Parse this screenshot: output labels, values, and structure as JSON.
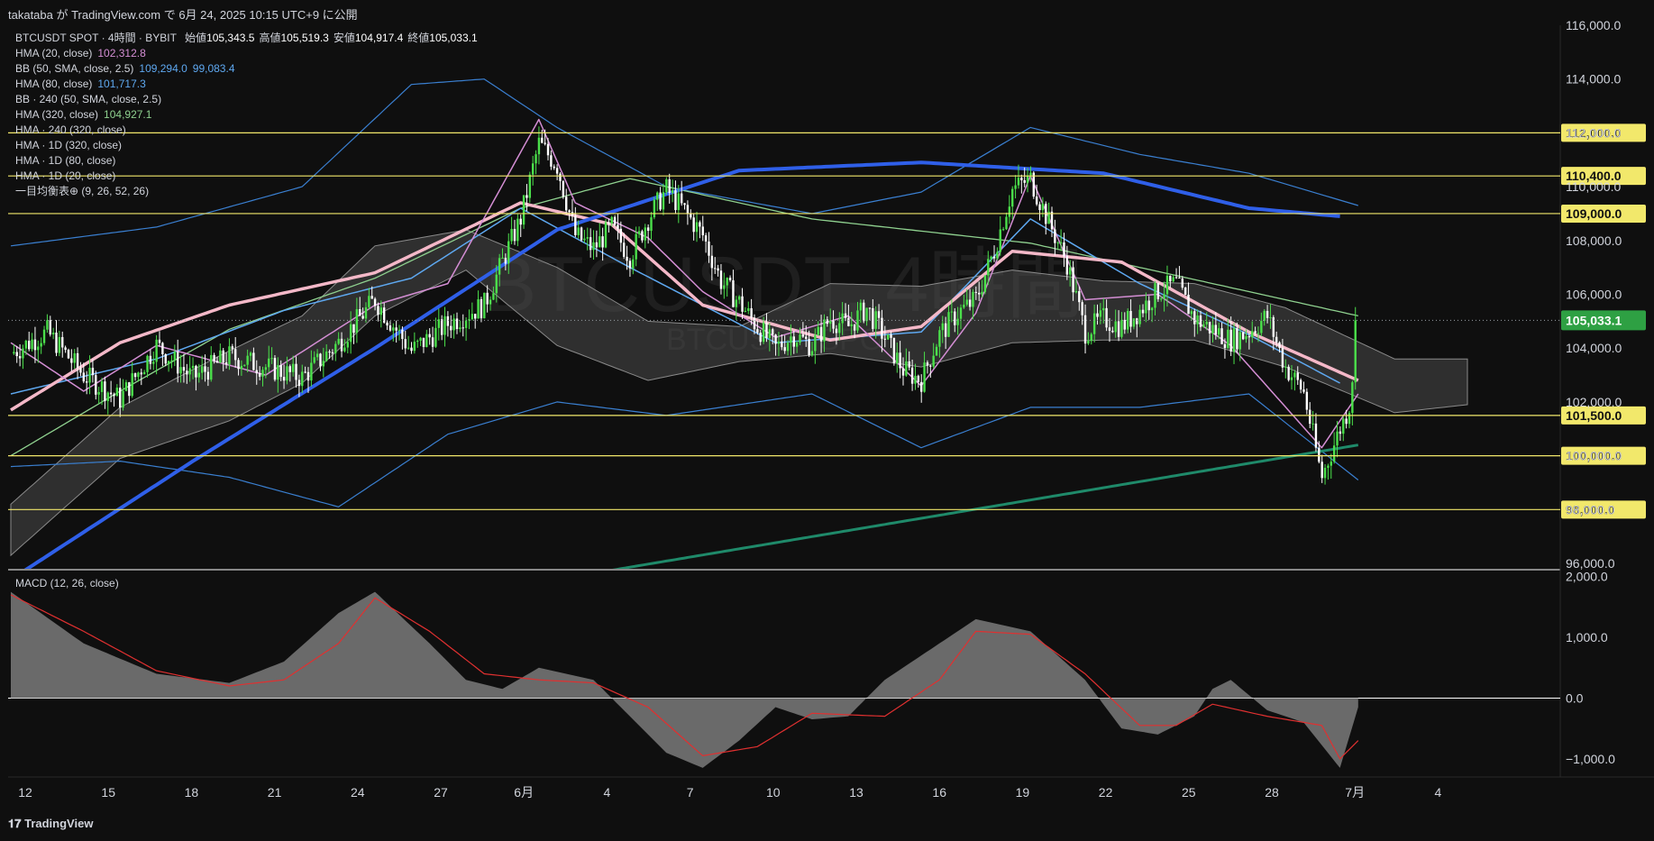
{
  "header": {
    "publish_text": "takataba が TradingView.com で 6月 24, 2025 10:15 UTC+9 に公開"
  },
  "watermark": {
    "line1": "BTCUSDT, 4時間",
    "line2": "BTCUSDT SPOT"
  },
  "legend": {
    "symbol": "BTCUSDT SPOT · 4時間 · BYBIT",
    "ohlc": [
      {
        "label": "始値",
        "value": "105,343.5"
      },
      {
        "label": "高値",
        "value": "105,519.3"
      },
      {
        "label": "安値",
        "value": "104,917.4"
      },
      {
        "label": "終値",
        "value": "105,033.1"
      }
    ],
    "indicators": [
      {
        "name": "HMA (20, close)",
        "values": [
          "102,312.8"
        ],
        "colors": [
          "#d48ed4"
        ]
      },
      {
        "name": "BB (50, SMA, close, 2.5)",
        "values": [
          "109,294.0",
          "99,083.4"
        ],
        "colors": [
          "#5ea8f0",
          "#5ea8f0"
        ]
      },
      {
        "name": "HMA (80, close)",
        "values": [
          "101,717.3"
        ],
        "colors": [
          "#5ea8f0"
        ]
      },
      {
        "name": "BB · 240 (50, SMA, close, 2.5)",
        "values": [],
        "colors": []
      },
      {
        "name": "HMA (320, close)",
        "values": [
          "104,927.1"
        ],
        "colors": [
          "#8fd18f"
        ]
      },
      {
        "name": "HMA · 240 (320, close)",
        "values": [],
        "colors": []
      },
      {
        "name": "HMA · 1D (320, close)",
        "values": [],
        "colors": []
      },
      {
        "name": "HMA · 1D (80, close)",
        "values": [],
        "colors": []
      },
      {
        "name": "HMA · 1D (20, close)",
        "values": [],
        "colors": []
      },
      {
        "name": "一目均衡表⊕ (9, 26, 52, 26)",
        "values": [],
        "colors": []
      }
    ]
  },
  "macd_label": "MACD (12, 26, close)",
  "footer": {
    "logo_text": "TradingView"
  },
  "colors": {
    "up": "#4be04b",
    "down": "#ffffff",
    "hline": "#f2e86b",
    "hma20": "#d48ed4",
    "hma80": "#5ea8f0",
    "hma320": "#8fd18f",
    "hma240": "#f4b8c8",
    "hma1d": "#2f5fe8",
    "trend": "#1f8a6a",
    "bb": "#3a7fd0",
    "cloud": "#4a4a4a",
    "macd_signal": "#e03030",
    "macd_hist": "#7a7a7a",
    "price_badge": "#2ea043",
    "level_badge": "#f2e86b"
  },
  "chart_data": [
    {
      "type": "candlestick",
      "title": "BTCUSDT SPOT · 4時間 · BYBIT",
      "xlabel": "",
      "ylabel": "",
      "x_ticks": [
        "12",
        "15",
        "18",
        "21",
        "24",
        "27",
        "6月",
        "4",
        "7",
        "10",
        "13",
        "16",
        "19",
        "22",
        "25",
        "28",
        "7月",
        "4"
      ],
      "y_ticks": [
        "96,000.0",
        "98,000.0",
        "100,000.0",
        "102,000.0",
        "104,000.0",
        "106,000.0",
        "108,000.0",
        "110,000.0",
        "112,000.0",
        "114,000.0",
        "116,000.0"
      ],
      "ylim": [
        95800,
        116000
      ],
      "last_price": {
        "value": 105033.1,
        "label": "105,033.1"
      },
      "horizontal_levels": [
        {
          "value": 112000,
          "label": "112,000.0"
        },
        {
          "value": 110400,
          "label": "110,400.0"
        },
        {
          "value": 109000,
          "label": "109,000.0"
        },
        {
          "value": 101500,
          "label": "101,500.0"
        },
        {
          "value": 100000,
          "label": "100,000.0"
        },
        {
          "value": 98000,
          "label": "98,000.0"
        }
      ],
      "price_path": [
        [
          0,
          103800
        ],
        [
          2,
          104600
        ],
        [
          4,
          103000
        ],
        [
          6,
          102100
        ],
        [
          8,
          104100
        ],
        [
          10,
          102900
        ],
        [
          12,
          103700
        ],
        [
          14,
          103300
        ],
        [
          16,
          102900
        ],
        [
          18,
          104200
        ],
        [
          20,
          105800
        ],
        [
          22,
          103900
        ],
        [
          24,
          104900
        ],
        [
          26,
          105600
        ],
        [
          28,
          108800
        ],
        [
          29,
          111600
        ],
        [
          30,
          110800
        ],
        [
          31,
          108200
        ],
        [
          32,
          107700
        ],
        [
          33,
          108500
        ],
        [
          34,
          107400
        ],
        [
          35,
          108800
        ],
        [
          36,
          109900
        ],
        [
          37,
          109100
        ],
        [
          38,
          108200
        ],
        [
          39,
          106500
        ],
        [
          40,
          105700
        ],
        [
          41,
          104800
        ],
        [
          42,
          104000
        ],
        [
          43,
          104500
        ],
        [
          44,
          104100
        ],
        [
          45,
          105100
        ],
        [
          46,
          104800
        ],
        [
          47,
          105500
        ],
        [
          48,
          104400
        ],
        [
          49,
          103200
        ],
        [
          50,
          102800
        ],
        [
          51,
          104500
        ],
        [
          52,
          105300
        ],
        [
          53,
          105800
        ],
        [
          54,
          107600
        ],
        [
          55,
          109900
        ],
        [
          56,
          110300
        ],
        [
          57,
          108700
        ],
        [
          58,
          107200
        ],
        [
          59,
          104600
        ],
        [
          60,
          105100
        ],
        [
          61,
          104800
        ],
        [
          62,
          105400
        ],
        [
          63,
          106100
        ],
        [
          64,
          106400
        ],
        [
          65,
          105100
        ],
        [
          66,
          104700
        ],
        [
          67,
          104300
        ],
        [
          68,
          104600
        ],
        [
          69,
          105200
        ],
        [
          70,
          103300
        ],
        [
          71,
          102400
        ],
        [
          72,
          99200
        ],
        [
          73,
          101000
        ],
        [
          73.5,
          101800
        ],
        [
          74,
          105033
        ]
      ],
      "overlays": {
        "hma1d_20": [
          [
            0,
            95400
          ],
          [
            10,
            99800
          ],
          [
            20,
            104000
          ],
          [
            30,
            108400
          ],
          [
            40,
            110600
          ],
          [
            50,
            110900
          ],
          [
            60,
            110500
          ],
          [
            68,
            109200
          ],
          [
            73,
            108900
          ]
        ],
        "hma240_320": [
          [
            0,
            101700
          ],
          [
            6,
            104200
          ],
          [
            12,
            105600
          ],
          [
            20,
            106800
          ],
          [
            28,
            109400
          ],
          [
            33,
            108600
          ],
          [
            38,
            105600
          ],
          [
            45,
            104300
          ],
          [
            50,
            104800
          ],
          [
            55,
            107600
          ],
          [
            61,
            107200
          ],
          [
            68,
            104600
          ],
          [
            74,
            102800
          ]
        ],
        "hma320": [
          [
            0,
            100000
          ],
          [
            6,
            102400
          ],
          [
            12,
            104700
          ],
          [
            20,
            106600
          ],
          [
            28,
            109200
          ],
          [
            34,
            110300
          ],
          [
            44,
            108800
          ],
          [
            56,
            107900
          ],
          [
            64,
            106700
          ],
          [
            74,
            105200
          ]
        ],
        "hma80": [
          [
            0,
            102300
          ],
          [
            8,
            103600
          ],
          [
            15,
            105400
          ],
          [
            22,
            106600
          ],
          [
            28,
            109200
          ],
          [
            34,
            107000
          ],
          [
            42,
            104200
          ],
          [
            50,
            104600
          ],
          [
            56,
            108800
          ],
          [
            62,
            106400
          ],
          [
            68,
            104500
          ],
          [
            73,
            102700
          ]
        ],
        "hma20": [
          [
            0,
            104200
          ],
          [
            4,
            102400
          ],
          [
            8,
            104100
          ],
          [
            14,
            103000
          ],
          [
            20,
            105600
          ],
          [
            24,
            106400
          ],
          [
            29,
            112500
          ],
          [
            31,
            109400
          ],
          [
            35,
            108100
          ],
          [
            38,
            106100
          ],
          [
            42,
            104400
          ],
          [
            46,
            105200
          ],
          [
            50,
            102600
          ],
          [
            53,
            105300
          ],
          [
            56,
            110400
          ],
          [
            59,
            105800
          ],
          [
            63,
            106000
          ],
          [
            67,
            104100
          ],
          [
            72,
            100300
          ],
          [
            74,
            102300
          ]
        ],
        "bb_upper": [
          [
            0,
            107800
          ],
          [
            8,
            108500
          ],
          [
            16,
            110000
          ],
          [
            22,
            113800
          ],
          [
            26,
            114000
          ],
          [
            30,
            112200
          ],
          [
            36,
            110000
          ],
          [
            44,
            109000
          ],
          [
            50,
            109800
          ],
          [
            56,
            112200
          ],
          [
            62,
            111200
          ],
          [
            68,
            110500
          ],
          [
            74,
            109300
          ]
        ],
        "bb_lower": [
          [
            0,
            99600
          ],
          [
            6,
            99800
          ],
          [
            12,
            99200
          ],
          [
            18,
            98100
          ],
          [
            24,
            100800
          ],
          [
            30,
            102000
          ],
          [
            36,
            101500
          ],
          [
            44,
            102300
          ],
          [
            50,
            100300
          ],
          [
            56,
            101800
          ],
          [
            62,
            101800
          ],
          [
            68,
            102300
          ],
          [
            74,
            99100
          ]
        ],
        "trendline": [
          [
            0,
            92000
          ],
          [
            74,
            100400
          ]
        ],
        "cloud_upper": [
          [
            0,
            98200
          ],
          [
            6,
            101800
          ],
          [
            12,
            103900
          ],
          [
            16,
            105200
          ],
          [
            20,
            107800
          ],
          [
            25,
            108400
          ],
          [
            30,
            107000
          ],
          [
            35,
            105000
          ],
          [
            40,
            104800
          ],
          [
            45,
            106400
          ],
          [
            50,
            106300
          ],
          [
            55,
            106900
          ],
          [
            60,
            106500
          ],
          [
            65,
            106400
          ],
          [
            70,
            105500
          ],
          [
            76,
            103600
          ],
          [
            80,
            103600
          ]
        ],
        "cloud_lower": [
          [
            0,
            96300
          ],
          [
            6,
            99900
          ],
          [
            12,
            101300
          ],
          [
            16,
            102700
          ],
          [
            20,
            105200
          ],
          [
            25,
            106900
          ],
          [
            30,
            104100
          ],
          [
            35,
            102800
          ],
          [
            40,
            103500
          ],
          [
            45,
            103800
          ],
          [
            50,
            103300
          ],
          [
            55,
            104200
          ],
          [
            60,
            104300
          ],
          [
            65,
            104300
          ],
          [
            70,
            103300
          ],
          [
            76,
            101600
          ],
          [
            80,
            101900
          ]
        ]
      }
    },
    {
      "type": "area",
      "title": "MACD (12, 26, close)",
      "y_ticks": [
        "2,000.0",
        "1,000.0",
        "0.0",
        "−1,000.0"
      ],
      "ylim": [
        -1300,
        2100
      ],
      "macd": [
        [
          0,
          1750
        ],
        [
          4,
          900
        ],
        [
          8,
          400
        ],
        [
          12,
          250
        ],
        [
          15,
          600
        ],
        [
          18,
          1400
        ],
        [
          20,
          1750
        ],
        [
          23,
          900
        ],
        [
          25,
          300
        ],
        [
          27,
          150
        ],
        [
          29,
          500
        ],
        [
          32,
          300
        ],
        [
          34,
          -300
        ],
        [
          36,
          -900
        ],
        [
          38,
          -1150
        ],
        [
          40,
          -700
        ],
        [
          42,
          -150
        ],
        [
          44,
          -350
        ],
        [
          46,
          -300
        ],
        [
          48,
          300
        ],
        [
          51,
          900
        ],
        [
          53,
          1300
        ],
        [
          56,
          1100
        ],
        [
          59,
          300
        ],
        [
          61,
          -500
        ],
        [
          63,
          -600
        ],
        [
          65,
          -300
        ],
        [
          66,
          150
        ],
        [
          67,
          300
        ],
        [
          69,
          -200
        ],
        [
          71,
          -400
        ],
        [
          73,
          -1150
        ],
        [
          74,
          -150
        ]
      ],
      "signal": [
        [
          0,
          1700
        ],
        [
          4,
          1100
        ],
        [
          8,
          450
        ],
        [
          12,
          200
        ],
        [
          15,
          300
        ],
        [
          18,
          900
        ],
        [
          20,
          1650
        ],
        [
          23,
          1100
        ],
        [
          26,
          400
        ],
        [
          29,
          300
        ],
        [
          32,
          250
        ],
        [
          35,
          -150
        ],
        [
          38,
          -950
        ],
        [
          41,
          -800
        ],
        [
          44,
          -250
        ],
        [
          48,
          -300
        ],
        [
          51,
          300
        ],
        [
          53,
          1100
        ],
        [
          56,
          1050
        ],
        [
          59,
          400
        ],
        [
          62,
          -450
        ],
        [
          64,
          -450
        ],
        [
          66,
          -100
        ],
        [
          69,
          -300
        ],
        [
          72,
          -450
        ],
        [
          73,
          -1000
        ],
        [
          74,
          -700
        ]
      ]
    }
  ]
}
